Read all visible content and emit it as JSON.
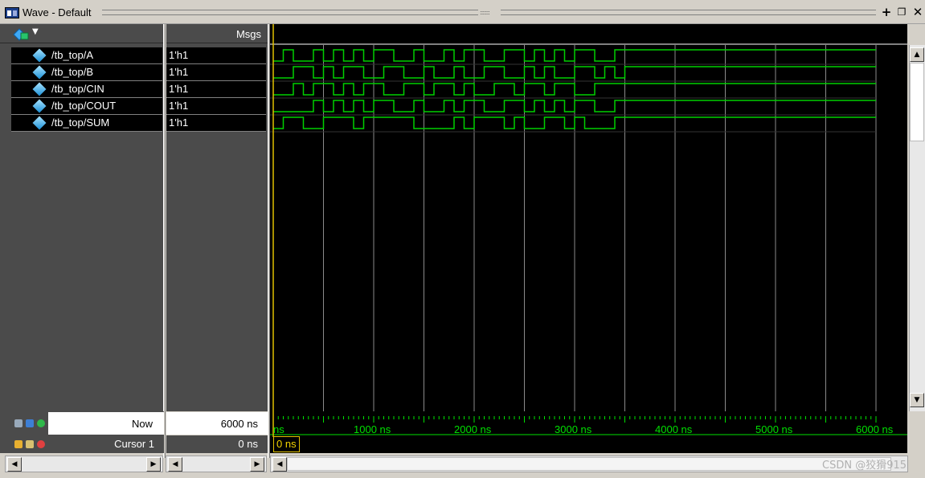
{
  "window": {
    "title": "Wave - Default",
    "dock_symbol": "+",
    "undock_symbol": "❐",
    "close_symbol": "✕"
  },
  "columns": {
    "msgs_header": "Msgs"
  },
  "signals": [
    {
      "name": "/tb_top/A",
      "value": "1'h1"
    },
    {
      "name": "/tb_top/B",
      "value": "1'h1"
    },
    {
      "name": "/tb_top/CIN",
      "value": "1'h1"
    },
    {
      "name": "/tb_top/COUT",
      "value": "1'h1"
    },
    {
      "name": "/tb_top/SUM",
      "value": "1'h1"
    }
  ],
  "cursors": {
    "now_label": "Now",
    "now_value": "6000 ns",
    "cursor_label": "Cursor 1",
    "cursor_value": "0 ns",
    "cursor_time_box": "0 ns"
  },
  "timeline": {
    "unit": "ns",
    "range_ns": [
      0,
      6000
    ],
    "ticks": [
      "ns",
      "1000 ns",
      "2000 ns",
      "3000 ns",
      "4000 ns",
      "5000 ns",
      "6000 ns"
    ]
  },
  "waveforms": {
    "A": [
      0,
      1,
      0,
      0,
      1,
      0,
      1,
      0,
      1,
      0,
      1,
      1,
      0,
      0,
      1,
      0,
      0,
      1,
      0,
      1,
      1,
      0,
      0,
      1,
      1,
      0,
      1,
      0,
      1,
      0,
      1,
      1,
      0,
      0,
      1,
      1,
      1,
      1,
      1,
      1,
      1,
      1,
      1,
      1,
      1,
      1,
      1,
      1,
      1,
      1,
      1,
      1,
      1,
      1,
      1,
      1,
      1,
      1,
      1,
      1
    ],
    "B": [
      0,
      0,
      1,
      1,
      0,
      1,
      0,
      1,
      1,
      0,
      0,
      1,
      1,
      0,
      0,
      1,
      0,
      0,
      1,
      0,
      0,
      1,
      1,
      0,
      0,
      1,
      0,
      1,
      0,
      0,
      1,
      1,
      0,
      1,
      0,
      1,
      1,
      1,
      1,
      1,
      1,
      1,
      1,
      1,
      1,
      1,
      1,
      1,
      1,
      1,
      1,
      1,
      1,
      1,
      1,
      1,
      1,
      1,
      1,
      1
    ],
    "CIN": [
      0,
      0,
      1,
      0,
      1,
      1,
      0,
      1,
      0,
      1,
      1,
      0,
      0,
      1,
      1,
      0,
      1,
      1,
      0,
      1,
      0,
      0,
      1,
      1,
      0,
      1,
      1,
      0,
      1,
      1,
      0,
      0,
      1,
      1,
      1,
      1,
      1,
      1,
      1,
      1,
      1,
      1,
      1,
      1,
      1,
      1,
      1,
      1,
      1,
      1,
      1,
      1,
      1,
      1,
      1,
      1,
      1,
      1,
      1,
      1
    ],
    "COUT": [
      0,
      0,
      0,
      0,
      1,
      0,
      1,
      0,
      1,
      0,
      1,
      1,
      0,
      0,
      1,
      0,
      0,
      1,
      0,
      1,
      1,
      0,
      0,
      1,
      1,
      0,
      1,
      0,
      1,
      0,
      1,
      1,
      0,
      0,
      1,
      1,
      1,
      1,
      1,
      1,
      1,
      1,
      1,
      1,
      1,
      1,
      1,
      1,
      1,
      1,
      1,
      1,
      1,
      1,
      1,
      1,
      1,
      1,
      1,
      1
    ],
    "SUM": [
      0,
      1,
      1,
      0,
      0,
      1,
      1,
      1,
      0,
      1,
      1,
      1,
      1,
      1,
      0,
      0,
      0,
      0,
      1,
      0,
      1,
      1,
      1,
      0,
      1,
      0,
      0,
      1,
      1,
      0,
      1,
      0,
      0,
      0,
      1,
      1,
      1,
      1,
      1,
      1,
      1,
      1,
      1,
      1,
      1,
      1,
      1,
      1,
      1,
      1,
      1,
      1,
      1,
      1,
      1,
      1,
      1,
      1,
      1,
      1
    ]
  },
  "colors": {
    "wave": "#00d000",
    "grid": "#8a8a8a",
    "cursor": "#e0c000",
    "timeline_text": "#00e000"
  },
  "watermark": "CSDN @狡猾915"
}
